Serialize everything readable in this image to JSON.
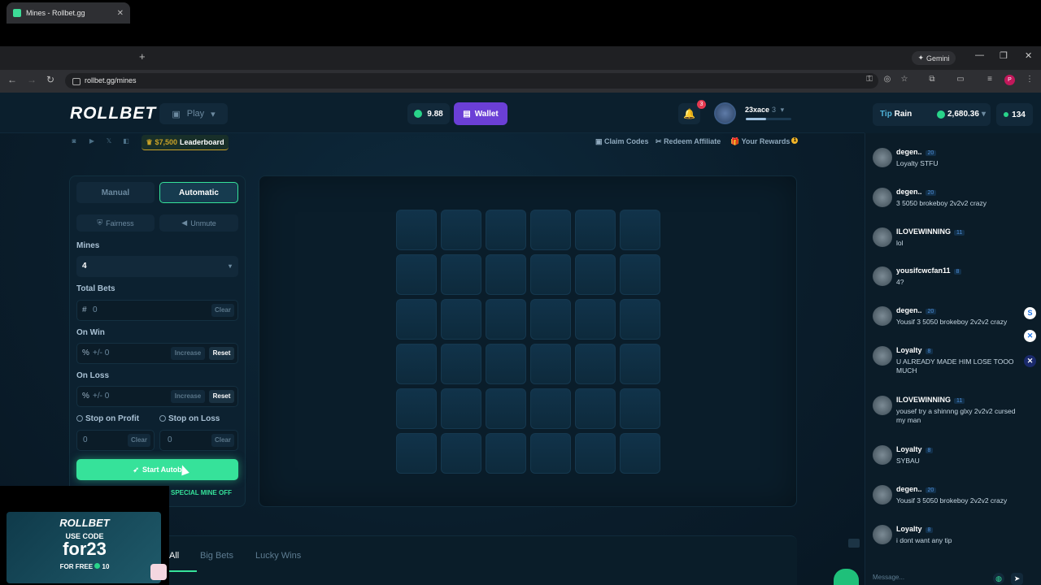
{
  "browser": {
    "tab_title": "Mines - Rollbet.gg",
    "new_tab": "+",
    "gemini_label": "Gemini",
    "url": "rollbet.gg/mines",
    "profile_initial": "P"
  },
  "header": {
    "logo": "ROLLBET",
    "play_label": "Play",
    "balance": "9.88",
    "wallet_label": "Wallet",
    "notif_count": "3",
    "username": "23xace",
    "user_level": "3",
    "xp_progress": 0.45
  },
  "subbar": {
    "leaderboard_amount": "$7,500",
    "leaderboard_label": "Leaderboard",
    "links": [
      "Claim Codes",
      "Redeem Affiliate",
      "Your Rewards"
    ],
    "rewards_badge": "1"
  },
  "panel": {
    "mode_manual": "Manual",
    "mode_auto": "Automatic",
    "fairness": "Fairness",
    "unmute": "Unmute",
    "mines_label": "Mines",
    "mines_value": "4",
    "total_bets_label": "Total Bets",
    "total_bets_prefix": "#",
    "total_bets_value": "0",
    "clear": "Clear",
    "on_win_label": "On Win",
    "on_loss_label": "On Loss",
    "pct_prefix": "%",
    "pct_value": "+/- 0",
    "increase": "Increase",
    "reset": "Reset",
    "stop_profit_label": "Stop on Profit",
    "stop_loss_label": "Stop on Loss",
    "stop_profit_value": "0",
    "stop_loss_value": "0",
    "start_label": "Start Autob",
    "special_label": "SPECIAL MINE OFF"
  },
  "board": {
    "rows": 6,
    "cols": 6
  },
  "bottom_tabs": [
    "All",
    "Big Bets",
    "Lucky Wins"
  ],
  "promo": {
    "logo": "ROLLBET",
    "use_code": "USE CODE",
    "code": "for23",
    "free": "FOR FREE",
    "free_amount": "10"
  },
  "rail": {
    "tip_label": "Tip",
    "rain_label": "Rain",
    "rain_amount": "2,680.36",
    "online_count": "134",
    "messages": [
      {
        "name": "degen..",
        "level": "20",
        "text": "Loyalty STFU"
      },
      {
        "name": "degen..",
        "level": "20",
        "text": "3 5050 brokeboy 2v2v2 crazy"
      },
      {
        "name": "ILOVEWINNING",
        "level": "11",
        "text": "lol"
      },
      {
        "name": "yousifcwcfan11",
        "level": "8",
        "text": "4?"
      },
      {
        "name": "degen..",
        "level": "20",
        "text": "Yousif 3 5050 brokeboy 2v2v2 crazy"
      },
      {
        "name": "Loyalty",
        "level": "8",
        "text": "U ALREADY MADE HIM LOSE TOOO MUCH"
      },
      {
        "name": "ILOVEWINNING",
        "level": "11",
        "text": "yousef try a shinnng glxy 2v2v2 cursed my man"
      },
      {
        "name": "Loyalty",
        "level": "8",
        "text": "SYBAU"
      },
      {
        "name": "degen..",
        "level": "20",
        "text": "Yousif 3 5050 brokeboy 2v2v2 crazy"
      },
      {
        "name": "Loyalty",
        "level": "8",
        "text": "i dont want any tip"
      }
    ],
    "input_placeholder": "Message..."
  },
  "colors": {
    "accent_green": "#36e29a",
    "wallet_purple": "#6b3fd6",
    "bg_dark": "#0a1d2b"
  }
}
